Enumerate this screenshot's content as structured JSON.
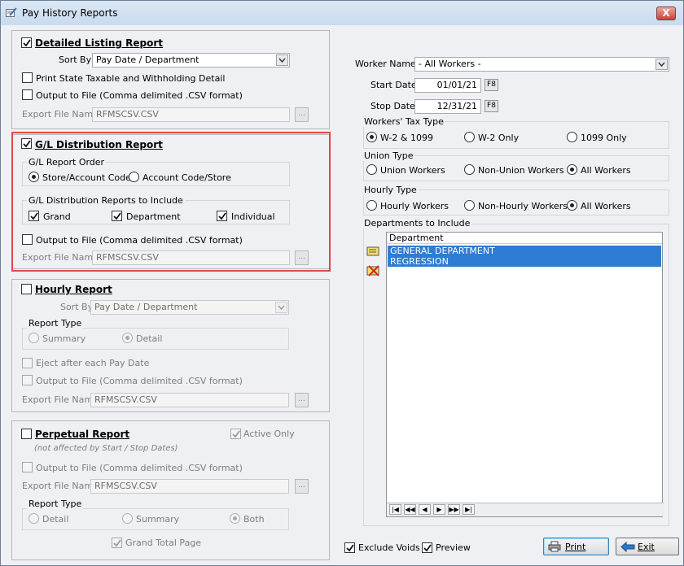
{
  "window": {
    "title": "Pay History Reports",
    "close_label": "X"
  },
  "detailed": {
    "label": "Detailed Listing Report",
    "checked": true,
    "sort_by_label": "Sort By",
    "sort_by_value": "Pay Date / Department",
    "print_state_label": "Print State Taxable and Withholding Detail",
    "output_label": "Output to File (Comma delimited .CSV format)",
    "export_label": "Export File Name",
    "export_value": "RFMSCSV.CSV",
    "browse_label": "..."
  },
  "gl": {
    "label": "G/L Distribution Report",
    "checked": true,
    "order_title": "G/L Report Order",
    "order_options": [
      "Store/Account Code",
      "Account Code/Store"
    ],
    "include_title": "G/L Distribution Reports to Include",
    "include_options": [
      "Grand",
      "Department",
      "Individual"
    ],
    "output_label": "Output to File (Comma delimited .CSV format)",
    "export_label": "Export File Name",
    "export_value": "RFMSCSV.CSV",
    "browse_label": "..."
  },
  "hourly": {
    "label": "Hourly Report",
    "checked": false,
    "sort_by_label": "Sort By",
    "sort_by_value": "Pay Date / Department",
    "report_type_title": "Report Type",
    "report_type_options": [
      "Summary",
      "Detail"
    ],
    "eject_label": "Eject after each Pay Date",
    "output_label": "Output to File (Comma delimited .CSV format)",
    "export_label": "Export File Name",
    "export_value": "RFMSCSV.CSV",
    "browse_label": "..."
  },
  "perpetual": {
    "label": "Perpetual Report",
    "checked": false,
    "active_only_label": "Active Only",
    "note": "(not affected by Start / Stop Dates)",
    "output_label": "Output to File (Comma delimited .CSV format)",
    "export_label": "Export File Name",
    "export_value": "RFMSCSV.CSV",
    "browse_label": "...",
    "report_type_title": "Report Type",
    "report_type_options": [
      "Detail",
      "Summary",
      "Both"
    ],
    "grand_total_label": "Grand Total Page"
  },
  "filters": {
    "worker_name_label": "Worker Name",
    "worker_name_value": "- All Workers -",
    "start_date_label": "Start Date",
    "start_date_value": "01/01/21",
    "stop_date_label": "Stop Date",
    "stop_date_value": "12/31/21",
    "f8_label": "F8",
    "tax_type_title": "Workers' Tax Type",
    "tax_type_options": [
      "W-2 & 1099",
      "W-2 Only",
      "1099 Only"
    ],
    "union_title": "Union Type",
    "union_options": [
      "Union Workers",
      "Non-Union Workers",
      "All Workers"
    ],
    "hourly_title": "Hourly Type",
    "hourly_options": [
      "Hourly Workers",
      "Non-Hourly Workers",
      "All Workers"
    ]
  },
  "departments": {
    "title": "Departments to Include",
    "column_header": "Department",
    "rows": [
      "GENERAL DEPARTMENT",
      "REGRESSION"
    ]
  },
  "footer": {
    "exclude_voids_label": "Exclude Voids",
    "preview_label": "Preview",
    "print_label": "Print",
    "exit_label": "Exit"
  },
  "colors": {
    "highlight": "#2e7cd3",
    "callout": "#e04848"
  }
}
